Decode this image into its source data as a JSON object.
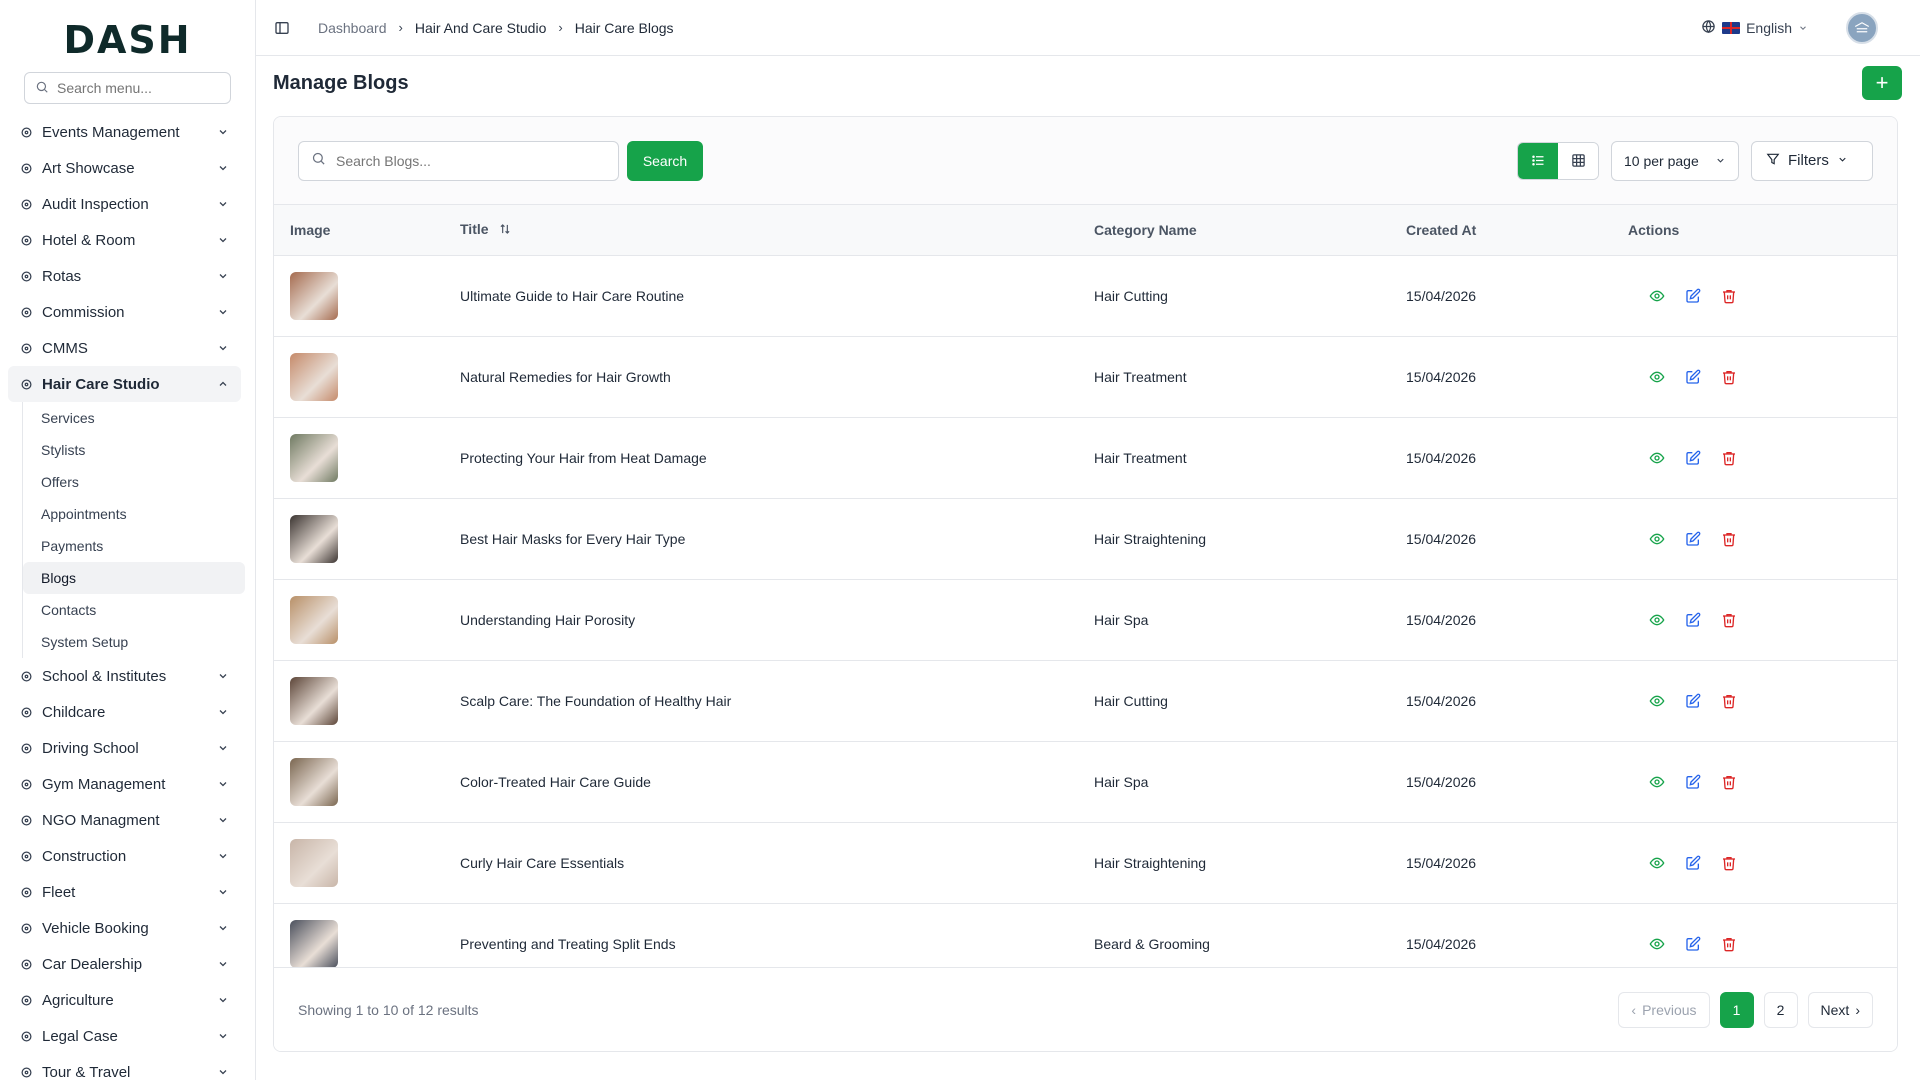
{
  "brand": {
    "logo_text": "DASH"
  },
  "sidebar": {
    "search_placeholder": "Search menu...",
    "items": [
      {
        "label": "Events Management",
        "icon": "party-icon"
      },
      {
        "label": "Art Showcase",
        "icon": "palette-icon"
      },
      {
        "label": "Audit Inspection",
        "icon": "search-check-icon"
      },
      {
        "label": "Hotel & Room",
        "icon": "hotel-icon"
      },
      {
        "label": "Rotas",
        "icon": "calendar-clock-icon"
      },
      {
        "label": "Commission",
        "icon": "trending-up-icon"
      },
      {
        "label": "CMMS",
        "icon": "cog-icon"
      },
      {
        "label": "Hair Care Studio",
        "icon": "sparkle-icon"
      }
    ],
    "active_group": "Hair Care Studio",
    "sub_items": [
      "Services",
      "Stylists",
      "Offers",
      "Appointments",
      "Payments",
      "Blogs",
      "Contacts",
      "System Setup"
    ],
    "active_sub": "Blogs",
    "items_after": [
      {
        "label": "School & Institutes",
        "icon": "school-icon"
      },
      {
        "label": "Childcare",
        "icon": "baby-icon"
      },
      {
        "label": "Driving School",
        "icon": "steering-wheel-icon"
      },
      {
        "label": "Gym Management",
        "icon": "dumbbell-icon"
      },
      {
        "label": "NGO Managment",
        "icon": "hand-heart-icon"
      },
      {
        "label": "Construction",
        "icon": "crane-icon"
      },
      {
        "label": "Fleet",
        "icon": "truck-icon"
      },
      {
        "label": "Vehicle Booking",
        "icon": "car-booking-icon"
      },
      {
        "label": "Car Dealership",
        "icon": "car-icon"
      },
      {
        "label": "Agriculture",
        "icon": "tractor-icon"
      },
      {
        "label": "Legal Case",
        "icon": "scale-icon"
      },
      {
        "label": "Tour & Travel",
        "icon": "plane-icon"
      }
    ]
  },
  "topbar": {
    "breadcrumbs": [
      "Dashboard",
      "Hair And Care Studio",
      "Hair Care Blogs"
    ],
    "language": "English"
  },
  "page": {
    "title": "Manage Blogs",
    "search_placeholder": "Search Blogs...",
    "search_button": "Search",
    "per_page": "10 per page",
    "filters_label": "Filters"
  },
  "table": {
    "columns": [
      "Image",
      "Title",
      "Category Name",
      "Created At",
      "Actions"
    ],
    "rows": [
      {
        "title": "Ultimate Guide to Hair Care Routine",
        "category": "Hair Cutting",
        "created": "15/04/2026",
        "thumb_color": "#a56b4f"
      },
      {
        "title": "Natural Remedies for Hair Growth",
        "category": "Hair Treatment",
        "created": "15/04/2026",
        "thumb_color": "#c58a6a"
      },
      {
        "title": "Protecting Your Hair from Heat Damage",
        "category": "Hair Treatment",
        "created": "15/04/2026",
        "thumb_color": "#6f7a62"
      },
      {
        "title": "Best Hair Masks for Every Hair Type",
        "category": "Hair Straightening",
        "created": "15/04/2026",
        "thumb_color": "#3b3431"
      },
      {
        "title": "Understanding Hair Porosity",
        "category": "Hair Spa",
        "created": "15/04/2026",
        "thumb_color": "#b89068"
      },
      {
        "title": "Scalp Care: The Foundation of Healthy Hair",
        "category": "Hair Cutting",
        "created": "15/04/2026",
        "thumb_color": "#5c4538"
      },
      {
        "title": "Color-Treated Hair Care Guide",
        "category": "Hair Spa",
        "created": "15/04/2026",
        "thumb_color": "#7a6650"
      },
      {
        "title": "Curly Hair Care Essentials",
        "category": "Hair Straightening",
        "created": "15/04/2026",
        "thumb_color": "#c8b5a8"
      },
      {
        "title": "Preventing and Treating Split Ends",
        "category": "Beard & Grooming",
        "created": "15/04/2026",
        "thumb_color": "#4a4f5c"
      }
    ]
  },
  "footer": {
    "showing": "Showing 1 to 10 of 12 results",
    "prev": "Previous",
    "pages": [
      "1",
      "2"
    ],
    "current_page": "1",
    "next": "Next"
  },
  "colors": {
    "accent": "#16a34a",
    "view_icon": "#16a34a",
    "edit_icon": "#2563eb",
    "delete_icon": "#dc2626"
  }
}
